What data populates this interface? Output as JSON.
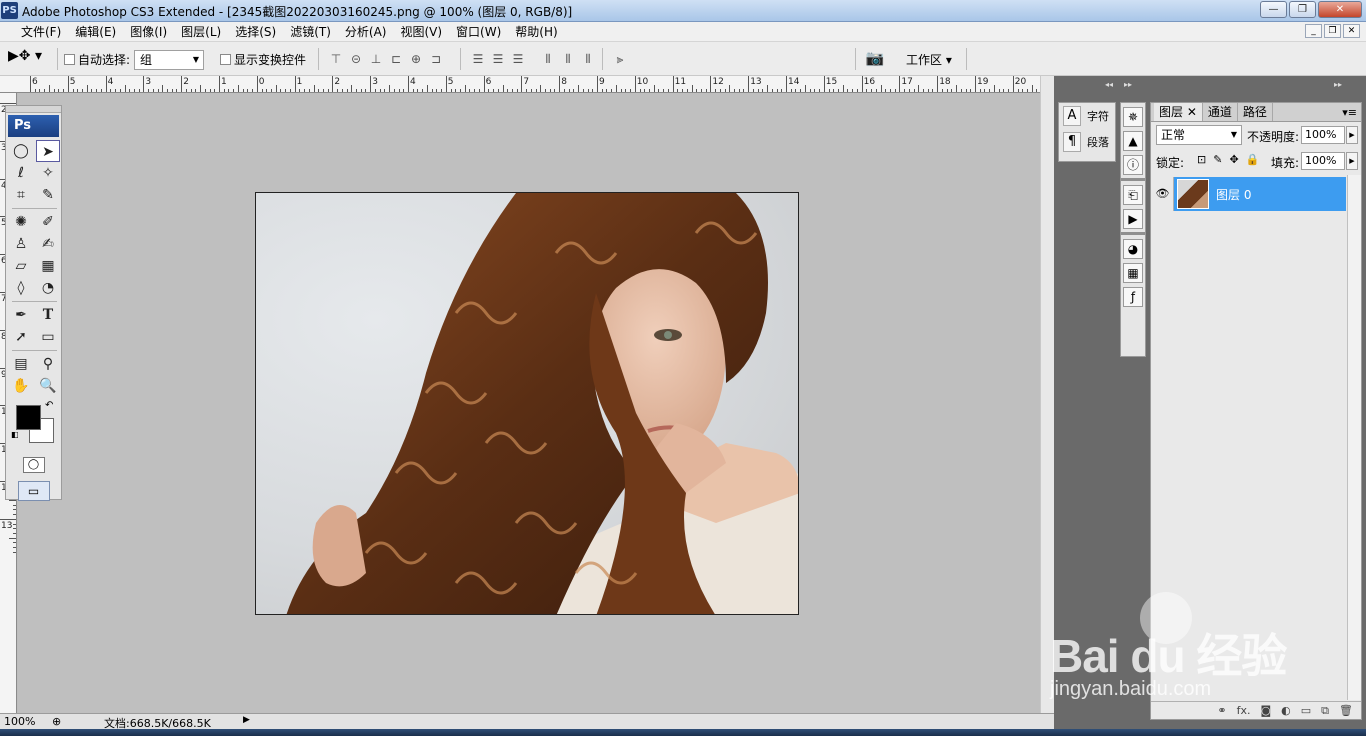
{
  "window": {
    "app_icon": "PS",
    "title": "Adobe Photoshop CS3 Extended - [2345截图20220303160245.png @ 100% (图层 0, RGB/8)]",
    "buttons": [
      "—",
      "❐",
      "✕"
    ]
  },
  "menu": {
    "items": [
      "文件(F)",
      "编辑(E)",
      "图像(I)",
      "图层(L)",
      "选择(S)",
      "滤镜(T)",
      "分析(A)",
      "视图(V)",
      "窗口(W)",
      "帮助(H)"
    ]
  },
  "options": {
    "auto_select_label": "自动选择:",
    "auto_select_value": "组",
    "show_transform_label": "显示变换控件",
    "workspace_label": "工作区 ▾"
  },
  "rulers": {
    "h_labels": [
      "6",
      "5",
      "4",
      "3",
      "2",
      "1",
      "0",
      "1",
      "2",
      "3",
      "4",
      "5",
      "6",
      "7",
      "8",
      "9",
      "10",
      "11",
      "12",
      "13",
      "14",
      "15",
      "16",
      "17",
      "18",
      "19",
      "20"
    ],
    "v_labels": [
      "2",
      "3",
      "4",
      "5",
      "6",
      "7",
      "8",
      "9",
      "10",
      "11",
      "12",
      "13"
    ]
  },
  "toolbox": {
    "logo": "Ps"
  },
  "status": {
    "zoom": "100%",
    "doc_info": "文档:668.5K/668.5K"
  },
  "side_panel": {
    "char_label": "字符",
    "para_label": "段落"
  },
  "layers_panel": {
    "tabs": [
      "图层",
      "通道",
      "路径"
    ],
    "blend_mode": "正常",
    "opacity_label": "不透明度:",
    "opacity_value": "100%",
    "lock_label": "锁定:",
    "fill_label": "填充:",
    "fill_value": "100%",
    "layer_name": "图层 0"
  },
  "watermark": {
    "main": "Bai du 经验",
    "sub": "jingyan.baidu.com"
  },
  "colors": {
    "foreground": "#000000",
    "background": "#ffffff",
    "selected_layer": "#3d9cf0"
  }
}
